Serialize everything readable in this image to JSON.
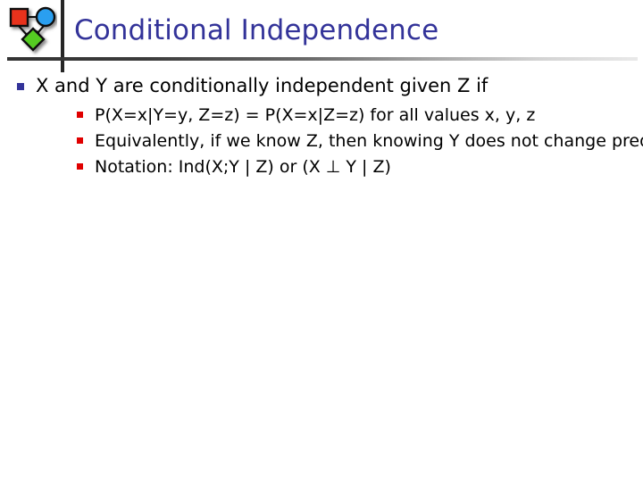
{
  "header": {
    "title": "Conditional Independence",
    "title_color": "#333399",
    "logo": {
      "name": "graph-nodes-logo",
      "nodes": [
        {
          "shape": "square",
          "color": "#e8321e",
          "label": "red-square-node"
        },
        {
          "shape": "circle",
          "color": "#2a9ff0",
          "label": "blue-circle-node"
        },
        {
          "shape": "diamond",
          "color": "#55cc22",
          "label": "green-diamond-node"
        }
      ]
    },
    "rule_gradient_from": "#333333",
    "rule_gradient_to": "#e9e9e9"
  },
  "content": {
    "bullet_color_level1": "#333399",
    "bullet_color_level2": "#e00000",
    "items": [
      {
        "level1": "X and Y are conditionally independent given Z if",
        "sub": [
          {
            "lines": [
              "P(X=x|Y=y, Z=z) = P(X=x|Z=z) for all values x, y, z"
            ]
          },
          {
            "lines": [
              "Equivalently, if we know Z, then knowing Y does not change",
              "predictions of X"
            ]
          },
          {
            "lines": [
              "Notation: Ind(X;Y | Z) or (X ⊥ Y | Z)"
            ]
          }
        ]
      }
    ]
  }
}
